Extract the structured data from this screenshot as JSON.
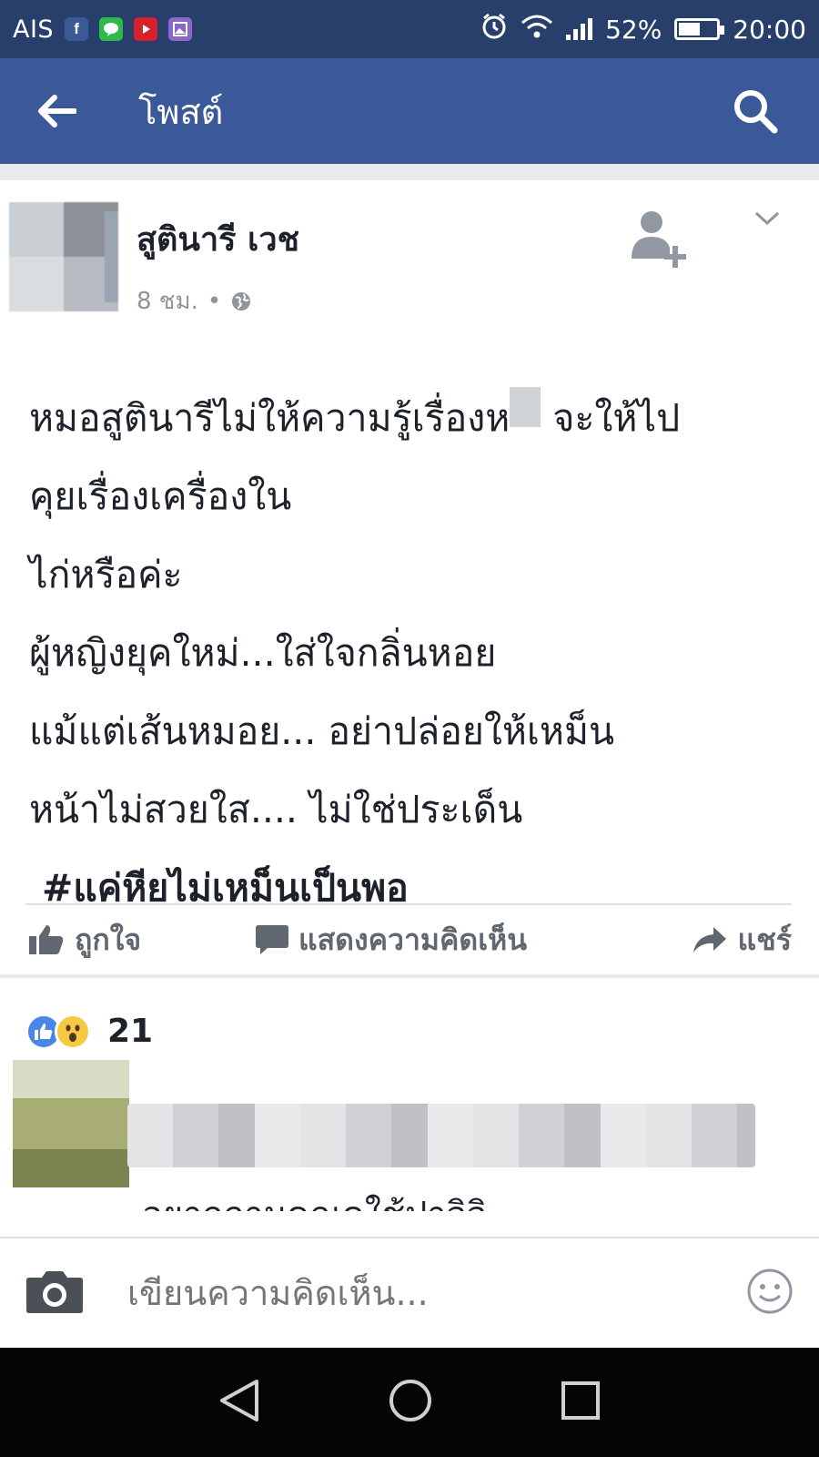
{
  "status_bar": {
    "carrier": "AIS",
    "app_icons": [
      "facebook-icon",
      "line-icon",
      "youtube-icon",
      "gallery-icon"
    ],
    "battery_percent": "52%",
    "battery_level": 0.52,
    "time": "20:00"
  },
  "app_bar": {
    "title": "โพสต์"
  },
  "post": {
    "author": "สูตินารี เวช",
    "time_ago": "8 ชม.",
    "separator": "•",
    "lines": [
      {
        "before": "หมอสูตินารีไม่ให้ความรู้เรื่องห",
        "after": " จะให้ไป"
      },
      "คุยเรื่องเครื่องใน",
      "ไก่หรือค่ะ",
      "ผู้หญิงยุคใหม่...ใส่ใจกลิ่นหอย",
      "แม้แต่เส้นหมอย... อย่าปล่อยให้เหม็น",
      "หน้าไม่สวยใส.... ไม่ใช่ประเด็น"
    ],
    "hashtag": "#แค่หียไม่เหม็นเป็นพอ"
  },
  "actions": {
    "like": "ถูกใจ",
    "comment": "แสดงความคิดเห็น",
    "share": "แชร์"
  },
  "reactions": {
    "count": "21"
  },
  "comment_preview": {
    "text": "อยากถามคุณคใช้ปาจิจิ"
  },
  "composer": {
    "placeholder": "เขียนความคิดเห็น..."
  },
  "colors": {
    "fb_blue": "#3b5998",
    "status_bar": "#293f6b",
    "background": "#e9ebee"
  }
}
